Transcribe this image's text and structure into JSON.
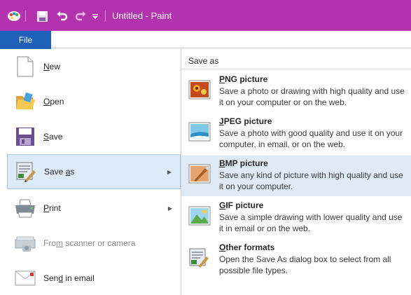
{
  "window": {
    "title": "Untitled - Paint"
  },
  "quick_access": {
    "icons": [
      "paint-app-icon",
      "save-icon",
      "undo-icon",
      "redo-icon",
      "customize-dropdown-icon"
    ]
  },
  "file_tab": {
    "label": "File"
  },
  "left_menu": {
    "items": [
      {
        "id": "new",
        "label_pre": "",
        "label_key": "N",
        "label_post": "ew",
        "icon": "new-document-icon"
      },
      {
        "id": "open",
        "label_pre": "",
        "label_key": "O",
        "label_post": "pen",
        "icon": "folder-open-icon"
      },
      {
        "id": "save",
        "label_pre": "",
        "label_key": "S",
        "label_post": "ave",
        "icon": "floppy-disk-icon"
      },
      {
        "id": "save-as",
        "label_pre": "Save ",
        "label_key": "a",
        "label_post": "s",
        "icon": "save-as-icon",
        "arrow": "▶"
      },
      {
        "id": "print",
        "label_pre": "",
        "label_key": "P",
        "label_post": "rint",
        "icon": "printer-icon",
        "arrow": "▶"
      },
      {
        "id": "scanner",
        "label_pre": "Fro",
        "label_key": "m",
        "label_post": " scanner or camera",
        "icon": "scanner-icon"
      },
      {
        "id": "email",
        "label_pre": "Sen",
        "label_key": "d",
        "label_post": " in email",
        "icon": "email-icon"
      }
    ]
  },
  "save_as_panel": {
    "title": "Save as",
    "items": [
      {
        "id": "png",
        "title_key": "P",
        "title_rest": "NG picture",
        "desc": "Save a photo or drawing with high quality and use it on your computer or on the web.",
        "icon": "png-picture-icon"
      },
      {
        "id": "jpeg",
        "title_key": "J",
        "title_rest": "PEG picture",
        "desc": "Save a photo with good quality and use it on your computer, in email, or on the web.",
        "icon": "jpeg-picture-icon"
      },
      {
        "id": "bmp",
        "title_key": "B",
        "title_rest": "MP picture",
        "desc": "Save any kind of picture with high quality and use it on your computer.",
        "icon": "bmp-picture-icon"
      },
      {
        "id": "gif",
        "title_key": "G",
        "title_rest": "IF picture",
        "desc": "Save a simple drawing with lower quality and use it in email or on the web.",
        "icon": "gif-picture-icon"
      },
      {
        "id": "other",
        "title_key": "O",
        "title_rest": "ther formats",
        "desc": "Open the Save As dialog box to select from all possible file types.",
        "icon": "other-formats-icon"
      }
    ]
  },
  "colors": {
    "titlebar": "#b332ad",
    "file_tab": "#1f61b9",
    "selection": "#ddeaf7"
  }
}
